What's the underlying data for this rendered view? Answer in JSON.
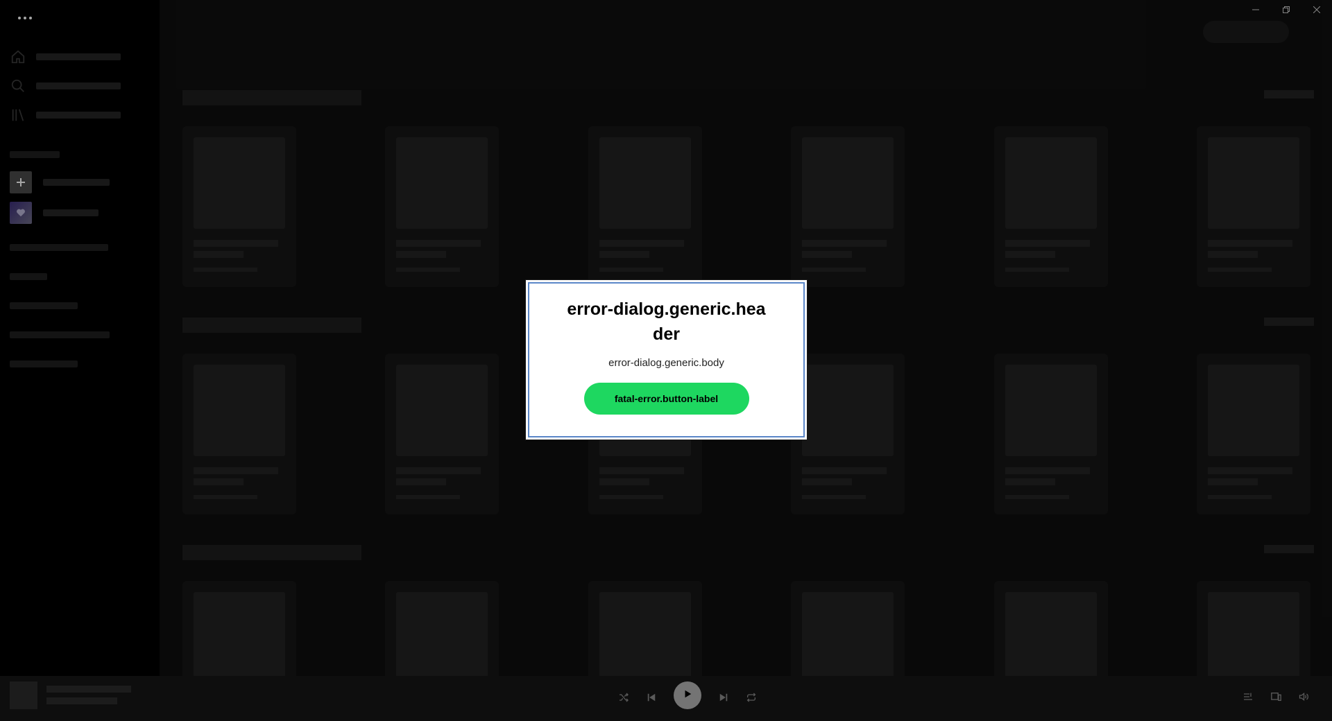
{
  "window": {
    "menu_icon": "more-horizontal-icon",
    "controls": [
      "minimize-icon",
      "restore-icon",
      "close-icon"
    ]
  },
  "sidebar": {
    "nav": [
      {
        "icon": "home-icon"
      },
      {
        "icon": "search-icon"
      },
      {
        "icon": "library-icon"
      }
    ],
    "library_items": [
      {
        "icon": "plus-icon"
      },
      {
        "icon": "heart-icon"
      }
    ]
  },
  "player": {
    "controls": [
      "shuffle-icon",
      "previous-icon",
      "play-icon",
      "next-icon",
      "repeat-icon"
    ],
    "right_controls": [
      "queue-icon",
      "devices-icon",
      "volume-icon"
    ]
  },
  "dialog": {
    "title": "error-dialog.generic.header",
    "body": "error-dialog.generic.body",
    "button_label": "fatal-error.button-label"
  },
  "colors": {
    "accent": "#1ed760",
    "background": "#000000",
    "main_bg": "#0f0f0f",
    "player_bg": "#161616",
    "skeleton": "#242424",
    "dialog_outline": "#5a86c8"
  }
}
